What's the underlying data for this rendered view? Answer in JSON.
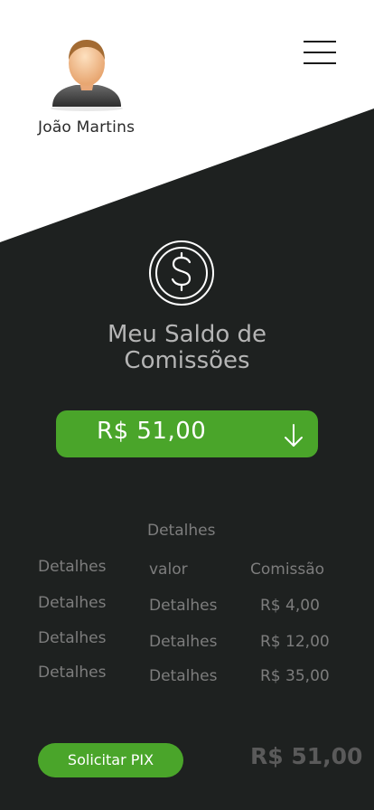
{
  "header": {
    "user_name": "João Martins",
    "avatar_icon": "user-avatar-icon",
    "menu_icon": "hamburger-menu-icon"
  },
  "balance": {
    "icon": "dollar-coin-icon",
    "title": "Meu Saldo de Comissões",
    "amount": "R$ 51,00",
    "expand_icon": "arrow-down-icon"
  },
  "table": {
    "header_top": "Detalhes",
    "headers": [
      "Detalhes",
      "valor",
      "Comissão"
    ],
    "rows": [
      [
        "Detalhes",
        "Detalhes",
        "R$ 4,00"
      ],
      [
        "Detalhes",
        "Detalhes",
        "R$ 12,00"
      ],
      [
        "Detalhes",
        "Detalhes",
        "R$ 35,00"
      ]
    ]
  },
  "footer": {
    "pix_button": "Solicitar PIX",
    "total": "R$ 51,00"
  },
  "colors": {
    "accent": "#4aa52a",
    "background_dark": "#1e2120",
    "background_light": "#ffffff"
  }
}
